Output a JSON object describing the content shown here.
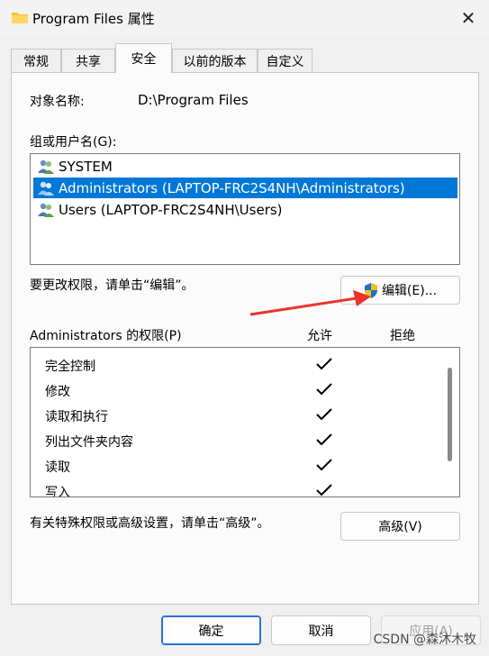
{
  "window": {
    "title": "Program Files 属性",
    "close": "✕"
  },
  "tabs": [
    {
      "label": "常规"
    },
    {
      "label": "共享"
    },
    {
      "label": "安全"
    },
    {
      "label": "以前的版本"
    },
    {
      "label": "自定义"
    }
  ],
  "object": {
    "label": "对象名称:",
    "value": "D:\\Program Files"
  },
  "groups": {
    "label": "组或用户名(G):",
    "items": [
      {
        "name": "SYSTEM",
        "selected": false
      },
      {
        "name": "Administrators (LAPTOP-FRC2S4NH\\Administrators)",
        "selected": true
      },
      {
        "name": "Users (LAPTOP-FRC2S4NH\\Users)",
        "selected": false
      }
    ]
  },
  "edit": {
    "hint": "要更改权限，请单击“编辑”。",
    "button": "编辑(E)..."
  },
  "permissions": {
    "label": "Administrators 的权限(P)",
    "allow": "允许",
    "deny": "拒绝",
    "rows": [
      {
        "name": "完全控制",
        "allow": true,
        "deny": false
      },
      {
        "name": "修改",
        "allow": true,
        "deny": false
      },
      {
        "name": "读取和执行",
        "allow": true,
        "deny": false
      },
      {
        "name": "列出文件夹内容",
        "allow": true,
        "deny": false
      },
      {
        "name": "读取",
        "allow": true,
        "deny": false
      },
      {
        "name": "写入",
        "allow": true,
        "deny": false
      }
    ]
  },
  "advanced": {
    "hint": "有关特殊权限或高级设置，请单击“高级”。",
    "button": "高级(V)"
  },
  "footer": {
    "ok": "确定",
    "cancel": "取消",
    "apply": "应用(A)"
  },
  "watermark": "CSDN @森沐木牧",
  "colors": {
    "selection": "#0078d7",
    "arrow": "#e8342d",
    "primary_border": "#2a6fd6"
  }
}
